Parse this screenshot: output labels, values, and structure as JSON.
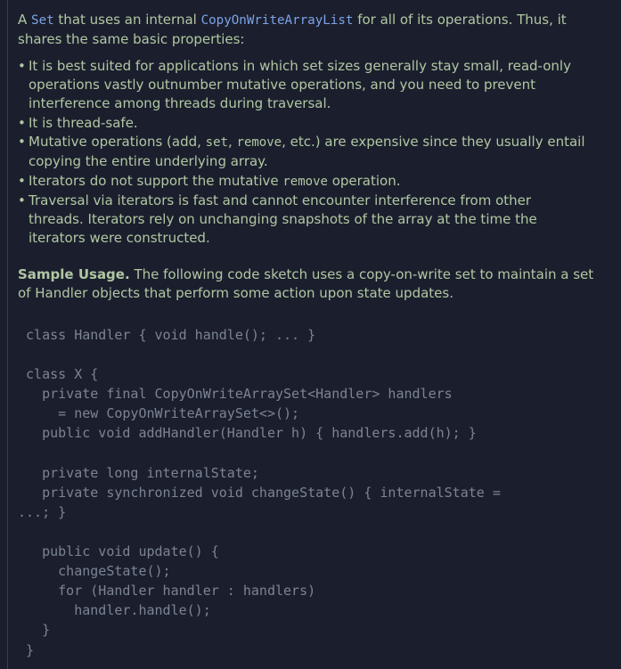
{
  "intro": {
    "prefix": "A ",
    "set_code": "Set",
    "middle": " that uses an internal ",
    "cow_code": "CopyOnWriteArrayList",
    "suffix": " for all of its operations. Thus, it shares the same basic properties:"
  },
  "bullets": [
    {
      "text": "It is best suited for applications in which set sizes generally stay small, read-only operations vastly outnumber mutative operations, and you need to prevent interference among threads during traversal."
    },
    {
      "text": "It is thread-safe."
    },
    {
      "pre": "Mutative operations (add, ",
      "code": "set",
      "mid": ", ",
      "code2": "remove",
      "post": ", etc.) are expensive since they usually entail copying the entire underlying array."
    },
    {
      "pre": "Iterators do not support the mutative ",
      "code": "remove",
      "post": " operation."
    },
    {
      "text": "Traversal via iterators is fast and cannot encounter interference from other threads. Iterators rely on unchanging snapshots of the array at the time the iterators were constructed."
    }
  ],
  "sample": {
    "label": "Sample Usage.",
    "text": " The following code sketch uses a copy-on-write set to maintain a set of Handler objects that perform some action upon state updates."
  },
  "code_block": " class Handler { void handle(); ... }\n\n class X {\n   private final CopyOnWriteArraySet<Handler> handlers\n     = new CopyOnWriteArraySet<>();\n   public void addHandler(Handler h) { handlers.add(h); }\n\n   private long internalState;\n   private synchronized void changeState() { internalState =\n...; }\n\n   public void update() {\n     changeState();\n     for (Handler handler : handlers)\n       handler.handle();\n   }\n }"
}
